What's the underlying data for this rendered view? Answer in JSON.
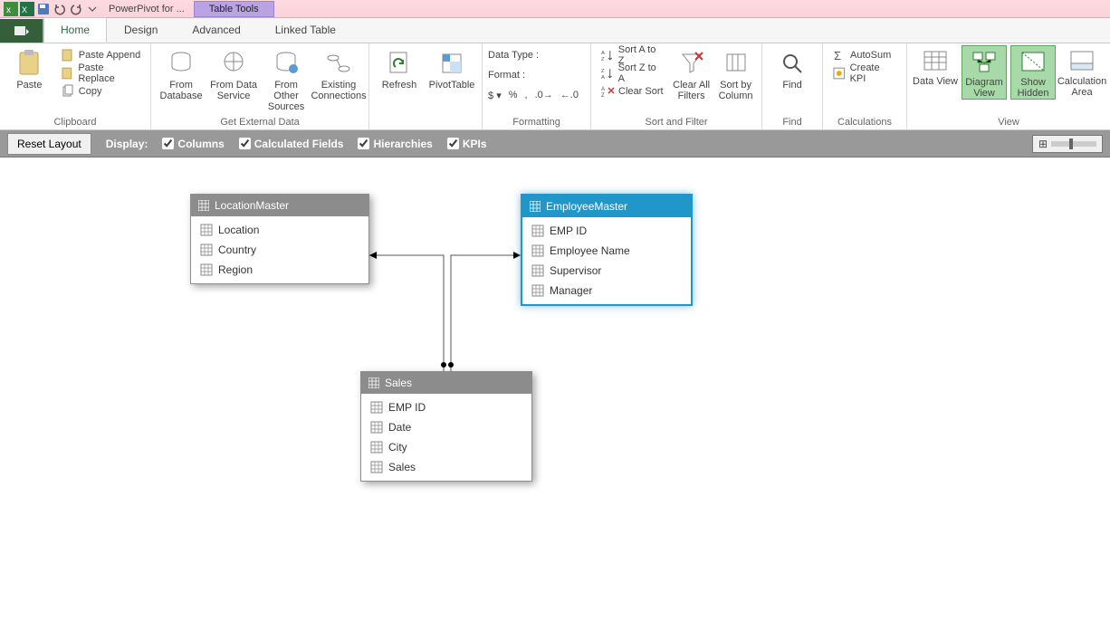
{
  "titlebar": {
    "app_title": "PowerPivot for ...",
    "context_tab": "Table Tools",
    "doc_title": ""
  },
  "tabs": {
    "file": "",
    "items": [
      "Home",
      "Design",
      "Advanced",
      "Linked Table"
    ],
    "active": "Home"
  },
  "ribbon": {
    "clipboard": {
      "paste": "Paste",
      "append": "Paste Append",
      "replace": "Paste Replace",
      "copy": "Copy",
      "label": "Clipboard"
    },
    "getdata": {
      "db": "From Database",
      "svc": "From Data Service",
      "other": "From Other Sources",
      "exist": "Existing Connections",
      "label": "Get External Data"
    },
    "refresh": "Refresh",
    "pivot": "PivotTable",
    "formatting": {
      "datatype": "Data Type :",
      "format": "Format :",
      "label": "Formatting"
    },
    "sort": {
      "az": "Sort A to Z",
      "za": "Sort Z to A",
      "clear": "Clear Sort",
      "clearfilters": "Clear All Filters",
      "bycol": "Sort by Column",
      "label": "Sort and Filter"
    },
    "find": {
      "find": "Find",
      "label": "Find"
    },
    "calc": {
      "autosum": "AutoSum",
      "kpi": "Create KPI",
      "label": "Calculations"
    },
    "view": {
      "data": "Data View",
      "diagram": "Diagram View",
      "hidden": "Show Hidden",
      "area": "Calculation Area",
      "label": "View"
    }
  },
  "toolbar": {
    "reset": "Reset Layout",
    "display": "Display:",
    "columns": "Columns",
    "calcfields": "Calculated Fields",
    "hierarchies": "Hierarchies",
    "kpis": "KPIs"
  },
  "nodes": {
    "location": {
      "title": "LocationMaster",
      "fields": [
        "Location",
        "Country",
        "Region"
      ]
    },
    "employee": {
      "title": "EmployeeMaster",
      "fields": [
        "EMP ID",
        "Employee Name",
        "Supervisor",
        "Manager"
      ]
    },
    "sales": {
      "title": "Sales",
      "fields": [
        "EMP ID",
        "Date",
        "City",
        "Sales"
      ]
    }
  }
}
